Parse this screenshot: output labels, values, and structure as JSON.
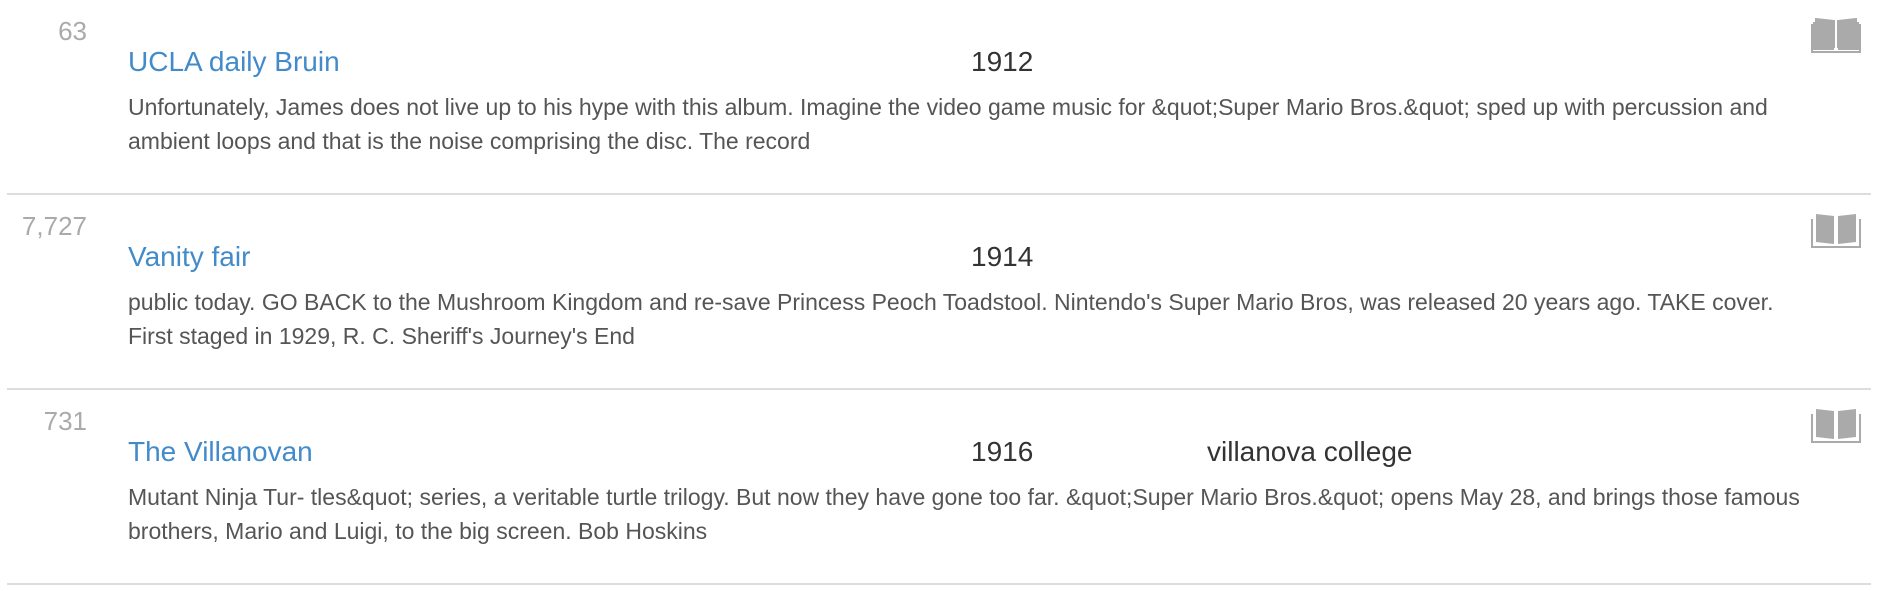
{
  "results": [
    {
      "count": "63",
      "title": "UCLA daily Bruin",
      "year": "1912",
      "publisher": "",
      "snippet": "Unfortunately, James does not live up to his hype with this album. Imagine the video game music for &quot;Super Mario Bros.&quot; sped up with percussion and ambient loops and that is the noise comprising the disc. The record",
      "icon": "book-icon"
    },
    {
      "count": "7,727",
      "title": "Vanity fair",
      "year": "1914",
      "publisher": "",
      "snippet": "public today. GO BACK to the Mushroom Kingdom and re-save Princess Peoch Toadstool. Nintendo's Super Mario Bros, was released 20 years ago. TAKE cover. First staged in 1929, R. C. Sheriff's Journey's End",
      "icon": "book-icon"
    },
    {
      "count": "731",
      "title": "The Villanovan",
      "year": "1916",
      "publisher": "villanova college",
      "snippet": "Mutant Ninja Tur- tles&quot; series, a veritable turtle trilogy. But now they have gone too far. &quot;Super Mario Bros.&quot; opens May 28, and brings those famous brothers, Mario and Luigi, to the big screen. Bob Hoskins",
      "icon": "book-icon"
    }
  ],
  "colors": {
    "link": "#428bca",
    "count": "#aaaaaa",
    "icon": "#aaaaaa",
    "divider": "#dddddd"
  }
}
